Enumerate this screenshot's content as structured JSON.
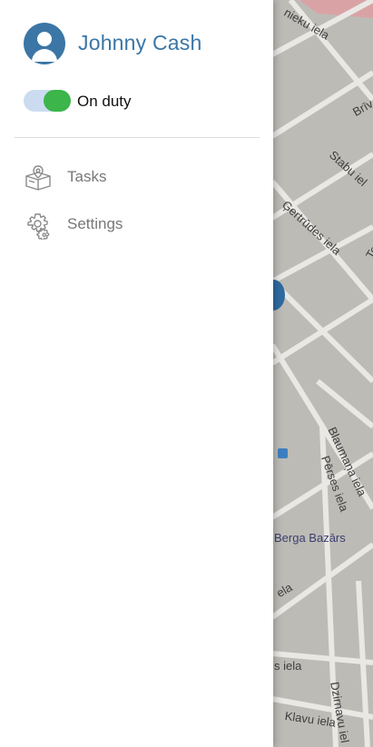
{
  "user": {
    "name": "Johnny Cash"
  },
  "duty": {
    "label": "On duty",
    "enabled": true
  },
  "menu": [
    {
      "label": "Tasks",
      "icon": "package-location-icon"
    },
    {
      "label": "Settings",
      "icon": "gear-icon"
    }
  ],
  "map": {
    "streets": [
      "nieku iela",
      "Brīv",
      "Stabu iel",
      "Ģertrūdes iela",
      "Te",
      "Blaumaņa iela",
      "Pērses iela",
      "ela",
      "s iela",
      "Dzirnavu iel",
      "Klavu iela"
    ],
    "poi": "Berga Bazārs"
  },
  "colors": {
    "accent": "#3b76a6",
    "toggle_on": "#3cb54a",
    "toggle_track": "#cbdcf0"
  }
}
